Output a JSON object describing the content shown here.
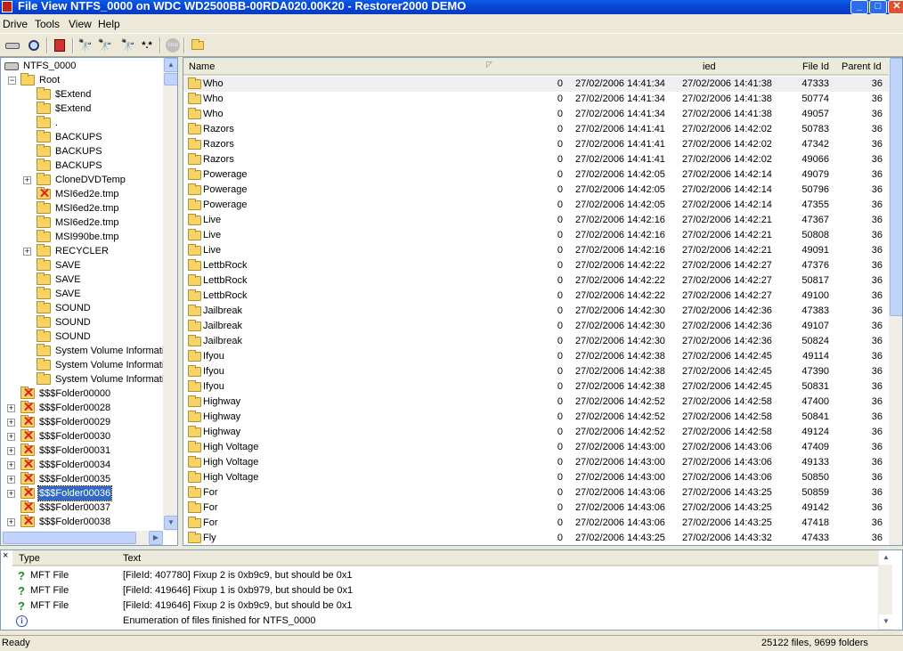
{
  "window": {
    "title": "File View NTFS_0000 on WDC WD2500BB-00RDA020.00K20 - Restorer2000 DEMO",
    "min": "_",
    "max": "□",
    "close": "✕"
  },
  "menu": [
    "Drive",
    "Tools",
    "View",
    "Help"
  ],
  "toolbar": {
    "icons": [
      "drive-icon",
      "scan-icon",
      "delete-recover-icon",
      "find-icon",
      "find-next-icon",
      "find-file-icon",
      "wildcard-icon",
      "stop-icon",
      "up-folder-icon"
    ],
    "wildcard_label": "*.*",
    "stop_label": "Stop"
  },
  "tree": {
    "items": [
      {
        "label": "NTFS_0000",
        "icon": "drive",
        "level": 0
      },
      {
        "label": "Root",
        "icon": "folder",
        "level": 1,
        "expander": "−"
      },
      {
        "label": "$Extend",
        "icon": "folder",
        "level": 2
      },
      {
        "label": "$Extend",
        "icon": "folder",
        "level": 2
      },
      {
        "label": ".",
        "icon": "folder",
        "level": 2
      },
      {
        "label": "BACKUPS",
        "icon": "folder",
        "level": 2
      },
      {
        "label": "BACKUPS",
        "icon": "folder",
        "level": 2
      },
      {
        "label": "BACKUPS",
        "icon": "folder",
        "level": 2
      },
      {
        "label": "CloneDVDTemp",
        "icon": "folder",
        "level": 2,
        "expander": "+"
      },
      {
        "label": "MSI6ed2e.tmp",
        "icon": "deleted",
        "level": 2
      },
      {
        "label": "MSI6ed2e.tmp",
        "icon": "folder",
        "level": 2
      },
      {
        "label": "MSI6ed2e.tmp",
        "icon": "folder",
        "level": 2
      },
      {
        "label": "MSI990be.tmp",
        "icon": "folder",
        "level": 2
      },
      {
        "label": "RECYCLER",
        "icon": "folder",
        "level": 2,
        "expander": "+"
      },
      {
        "label": "SAVE",
        "icon": "folder",
        "level": 2
      },
      {
        "label": "SAVE",
        "icon": "folder",
        "level": 2
      },
      {
        "label": "SAVE",
        "icon": "folder",
        "level": 2
      },
      {
        "label": "SOUND",
        "icon": "folder",
        "level": 2
      },
      {
        "label": "SOUND",
        "icon": "folder",
        "level": 2
      },
      {
        "label": "SOUND",
        "icon": "folder",
        "level": 2
      },
      {
        "label": "System Volume Informati",
        "icon": "folder",
        "level": 2
      },
      {
        "label": "System Volume Informati",
        "icon": "folder",
        "level": 2
      },
      {
        "label": "System Volume Informati",
        "icon": "folder",
        "level": 2
      },
      {
        "label": "$$$Folder00000",
        "icon": "deleted",
        "level": 1
      },
      {
        "label": "$$$Folder00028",
        "icon": "deleted",
        "level": 1,
        "expander": "+"
      },
      {
        "label": "$$$Folder00029",
        "icon": "deleted",
        "level": 1,
        "expander": "+"
      },
      {
        "label": "$$$Folder00030",
        "icon": "deleted",
        "level": 1,
        "expander": "+"
      },
      {
        "label": "$$$Folder00031",
        "icon": "deleted",
        "level": 1,
        "expander": "+"
      },
      {
        "label": "$$$Folder00034",
        "icon": "deleted",
        "level": 1,
        "expander": "+"
      },
      {
        "label": "$$$Folder00035",
        "icon": "deleted",
        "level": 1,
        "expander": "+"
      },
      {
        "label": "$$$Folder00036",
        "icon": "deleted",
        "level": 1,
        "expander": "+",
        "selected": true
      },
      {
        "label": "$$$Folder00037",
        "icon": "deleted",
        "level": 1
      },
      {
        "label": "$$$Folder00038",
        "icon": "deleted",
        "level": 1,
        "expander": "+"
      }
    ]
  },
  "list": {
    "columns": {
      "name": "Name",
      "modified": "ied",
      "file_id": "File Id",
      "parent_id": "Parent Id"
    },
    "rows": [
      [
        "Who",
        "0",
        "27/02/2006 14:41:34",
        "27/02/2006 14:41:38",
        "47333",
        "36"
      ],
      [
        "Who",
        "0",
        "27/02/2006 14:41:34",
        "27/02/2006 14:41:38",
        "50774",
        "36"
      ],
      [
        "Who",
        "0",
        "27/02/2006 14:41:34",
        "27/02/2006 14:41:38",
        "49057",
        "36"
      ],
      [
        "Razors",
        "0",
        "27/02/2006 14:41:41",
        "27/02/2006 14:42:02",
        "50783",
        "36"
      ],
      [
        "Razors",
        "0",
        "27/02/2006 14:41:41",
        "27/02/2006 14:42:02",
        "47342",
        "36"
      ],
      [
        "Razors",
        "0",
        "27/02/2006 14:41:41",
        "27/02/2006 14:42:02",
        "49066",
        "36"
      ],
      [
        "Powerage",
        "0",
        "27/02/2006 14:42:05",
        "27/02/2006 14:42:14",
        "49079",
        "36"
      ],
      [
        "Powerage",
        "0",
        "27/02/2006 14:42:05",
        "27/02/2006 14:42:14",
        "50796",
        "36"
      ],
      [
        "Powerage",
        "0",
        "27/02/2006 14:42:05",
        "27/02/2006 14:42:14",
        "47355",
        "36"
      ],
      [
        "Live",
        "0",
        "27/02/2006 14:42:16",
        "27/02/2006 14:42:21",
        "47367",
        "36"
      ],
      [
        "Live",
        "0",
        "27/02/2006 14:42:16",
        "27/02/2006 14:42:21",
        "50808",
        "36"
      ],
      [
        "Live",
        "0",
        "27/02/2006 14:42:16",
        "27/02/2006 14:42:21",
        "49091",
        "36"
      ],
      [
        "LettbRock",
        "0",
        "27/02/2006 14:42:22",
        "27/02/2006 14:42:27",
        "47376",
        "36"
      ],
      [
        "LettbRock",
        "0",
        "27/02/2006 14:42:22",
        "27/02/2006 14:42:27",
        "50817",
        "36"
      ],
      [
        "LettbRock",
        "0",
        "27/02/2006 14:42:22",
        "27/02/2006 14:42:27",
        "49100",
        "36"
      ],
      [
        "Jailbreak",
        "0",
        "27/02/2006 14:42:30",
        "27/02/2006 14:42:36",
        "47383",
        "36"
      ],
      [
        "Jailbreak",
        "0",
        "27/02/2006 14:42:30",
        "27/02/2006 14:42:36",
        "49107",
        "36"
      ],
      [
        "Jailbreak",
        "0",
        "27/02/2006 14:42:30",
        "27/02/2006 14:42:36",
        "50824",
        "36"
      ],
      [
        "Ifyou",
        "0",
        "27/02/2006 14:42:38",
        "27/02/2006 14:42:45",
        "49114",
        "36"
      ],
      [
        "Ifyou",
        "0",
        "27/02/2006 14:42:38",
        "27/02/2006 14:42:45",
        "47390",
        "36"
      ],
      [
        "Ifyou",
        "0",
        "27/02/2006 14:42:38",
        "27/02/2006 14:42:45",
        "50831",
        "36"
      ],
      [
        "Highway",
        "0",
        "27/02/2006 14:42:52",
        "27/02/2006 14:42:58",
        "47400",
        "36"
      ],
      [
        "Highway",
        "0",
        "27/02/2006 14:42:52",
        "27/02/2006 14:42:58",
        "50841",
        "36"
      ],
      [
        "Highway",
        "0",
        "27/02/2006 14:42:52",
        "27/02/2006 14:42:58",
        "49124",
        "36"
      ],
      [
        "High Voltage",
        "0",
        "27/02/2006 14:43:00",
        "27/02/2006 14:43:06",
        "47409",
        "36"
      ],
      [
        "High Voltage",
        "0",
        "27/02/2006 14:43:00",
        "27/02/2006 14:43:06",
        "49133",
        "36"
      ],
      [
        "High Voltage",
        "0",
        "27/02/2006 14:43:00",
        "27/02/2006 14:43:06",
        "50850",
        "36"
      ],
      [
        "For",
        "0",
        "27/02/2006 14:43:06",
        "27/02/2006 14:43:25",
        "50859",
        "36"
      ],
      [
        "For",
        "0",
        "27/02/2006 14:43:06",
        "27/02/2006 14:43:25",
        "49142",
        "36"
      ],
      [
        "For",
        "0",
        "27/02/2006 14:43:06",
        "27/02/2006 14:43:25",
        "47418",
        "36"
      ],
      [
        "Fly",
        "0",
        "27/02/2006 14:43:25",
        "27/02/2006 14:43:32",
        "47433",
        "36"
      ]
    ]
  },
  "log": {
    "close": "×",
    "columns": {
      "type": "Type",
      "text": "Text"
    },
    "rows": [
      {
        "icon": "question",
        "type": "MFT File",
        "text": "[FileId: 407780] Fixup 2 is 0xb9c9, but should be 0x1"
      },
      {
        "icon": "question",
        "type": "MFT File",
        "text": "[FileId: 419646] Fixup 1 is 0xb979, but should be 0x1"
      },
      {
        "icon": "question",
        "type": "MFT File",
        "text": "[FileId: 419646] Fixup 2 is 0xb9c9, but should be 0x1"
      },
      {
        "icon": "info",
        "type": "",
        "text": "Enumeration of files finished for NTFS_0000"
      }
    ]
  },
  "status": {
    "left": "Ready",
    "right": "25122 files, 9699 folders"
  }
}
